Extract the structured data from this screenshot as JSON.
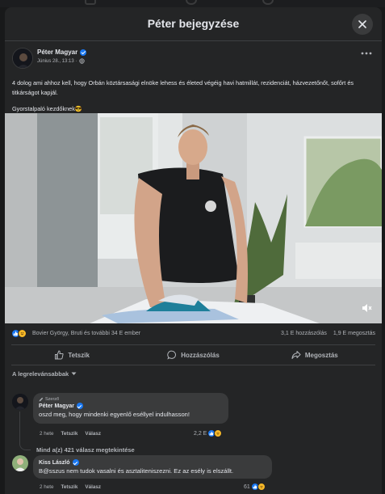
{
  "modal": {
    "title": "Péter bejegyzése"
  },
  "post": {
    "author": "Péter Magyar",
    "date": "Június 28., 13:13",
    "text": "4 dolog ami ahhoz kell, hogy Orbán köztársasági elnöke lehess és életed végéig havi hatmillát, rezidenciát, házvezetőnőt, sofőrt és titkárságot kapjál.",
    "text2": "Gyorstalpaló kezdőknek😎",
    "reactors": "Bovier György, Bruti és további 34 E ember",
    "comments_count": "3,1 E hozzászólás",
    "shares_count": "1,9 E megosztás"
  },
  "actions": {
    "like": "Tetszik",
    "comment": "Hozzászólás",
    "share": "Megosztás"
  },
  "sort": {
    "label": "A legrelevánsabbak"
  },
  "comments": [
    {
      "badge": "Szerző",
      "name": "Péter Magyar",
      "text": "oszd meg, hogy mindenki egyenlő eséllyel indulhasson!",
      "time": "2 hete",
      "like": "Tetszik",
      "reply": "Válasz",
      "reactions": "2,2 E",
      "view_replies": "Mind a(z) 421 válasz megtekintése"
    },
    {
      "name": "Kiss László",
      "text": "B@sszus nem tudok vasalni és asztaliteniszezni. Ez az esély is elszállt.",
      "time": "2 hete",
      "like": "Tetszik",
      "reply": "Válasz",
      "reactions": "61"
    }
  ],
  "colors": {
    "background": "#242526",
    "bubble": "#3a3b3c",
    "accent": "#1877f2",
    "muted_text": "#b0b3b8"
  }
}
